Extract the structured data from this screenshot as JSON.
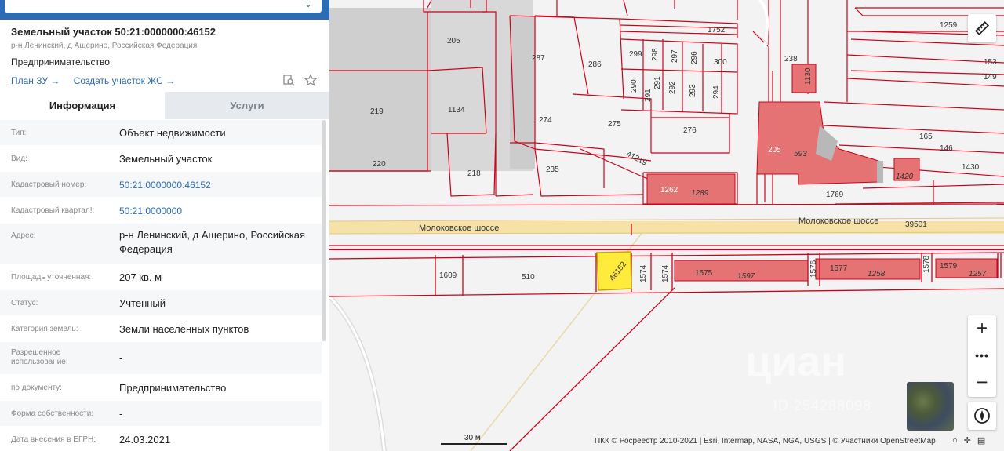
{
  "object": {
    "title": "Земельный участок 50:21:0000000:46152",
    "subtitle": "р-н Ленинский, д Ащерино, Российская Федерация",
    "use": "Предпринимательство",
    "links": [
      "План ЗУ →",
      "Создать участок ЖС →"
    ],
    "icons": [
      "search-doc-icon",
      "star-icon"
    ]
  },
  "tabs": [
    {
      "label": "Информация",
      "active": true
    },
    {
      "label": "Услуги",
      "active": false
    }
  ],
  "info_rows": [
    {
      "key": "Тип:",
      "value": "Объект недвижимости"
    },
    {
      "key": "Вид:",
      "value": "Земельный участок"
    },
    {
      "key": "Кадастровый номер:",
      "value": "50:21:0000000:46152",
      "link": true
    },
    {
      "key": "Кадастровый квартал!:",
      "value": "50:21:0000000",
      "link": true
    },
    {
      "key": "Адрес:",
      "value": "р-н Ленинский, д Ащерино, Российская Федерация"
    },
    {
      "key": "Площадь уточненная:",
      "value": "207 кв. м"
    },
    {
      "key": "Статус:",
      "value": "Учтенный"
    },
    {
      "key": "Категория земель:",
      "value": "Земли населённых пунктов"
    },
    {
      "key": "Разрешенное использование:",
      "value": "-"
    },
    {
      "key": "по документу:",
      "value": "Предпринимательство"
    },
    {
      "key": "Форма собственности:",
      "value": "-"
    },
    {
      "key": "Дата внесения в ЕГРН:",
      "value": "24.03.2021"
    }
  ],
  "map": {
    "road_name": "Молоковское шоссе",
    "road_number": "39501",
    "selected_parcel": "46152",
    "parcel_labels": [
      "1752",
      "1259",
      "205",
      "287",
      "286",
      "299",
      "298",
      "297",
      "296",
      "300",
      "238",
      "1130",
      "153",
      "149",
      "219",
      "1134",
      "290",
      "291",
      "291",
      "292",
      "293",
      "294",
      "274",
      "275",
      "276",
      "165",
      "146",
      "220",
      "218",
      "235",
      "41219",
      "205",
      "593",
      "1420",
      "1430",
      "1262",
      "1289",
      "1769",
      "1609",
      "510",
      "1574",
      "1574",
      "1575",
      "1597",
      "1576",
      "1577",
      "1258",
      "1578",
      "1579",
      "1257"
    ],
    "scale_label": "30 м",
    "attribution": "ПКК © Росреестр 2010-2021 | Esri, Intermap, NASA, NGA, USGS | © Участники OpenStreetMap",
    "watermark": "циан",
    "watermark_id": "ID 254288098",
    "controls": {
      "ruler": "ruler-icon",
      "zoom_in": "+",
      "more": "•••",
      "zoom_out": "−",
      "compass": "compass-icon"
    }
  },
  "colors": {
    "accent": "#2b6cb5",
    "parcel_border": "#d0021b",
    "building_fill": "#e57373",
    "selected_parcel": "#ffeb3b",
    "road": "#f6e2a6"
  }
}
